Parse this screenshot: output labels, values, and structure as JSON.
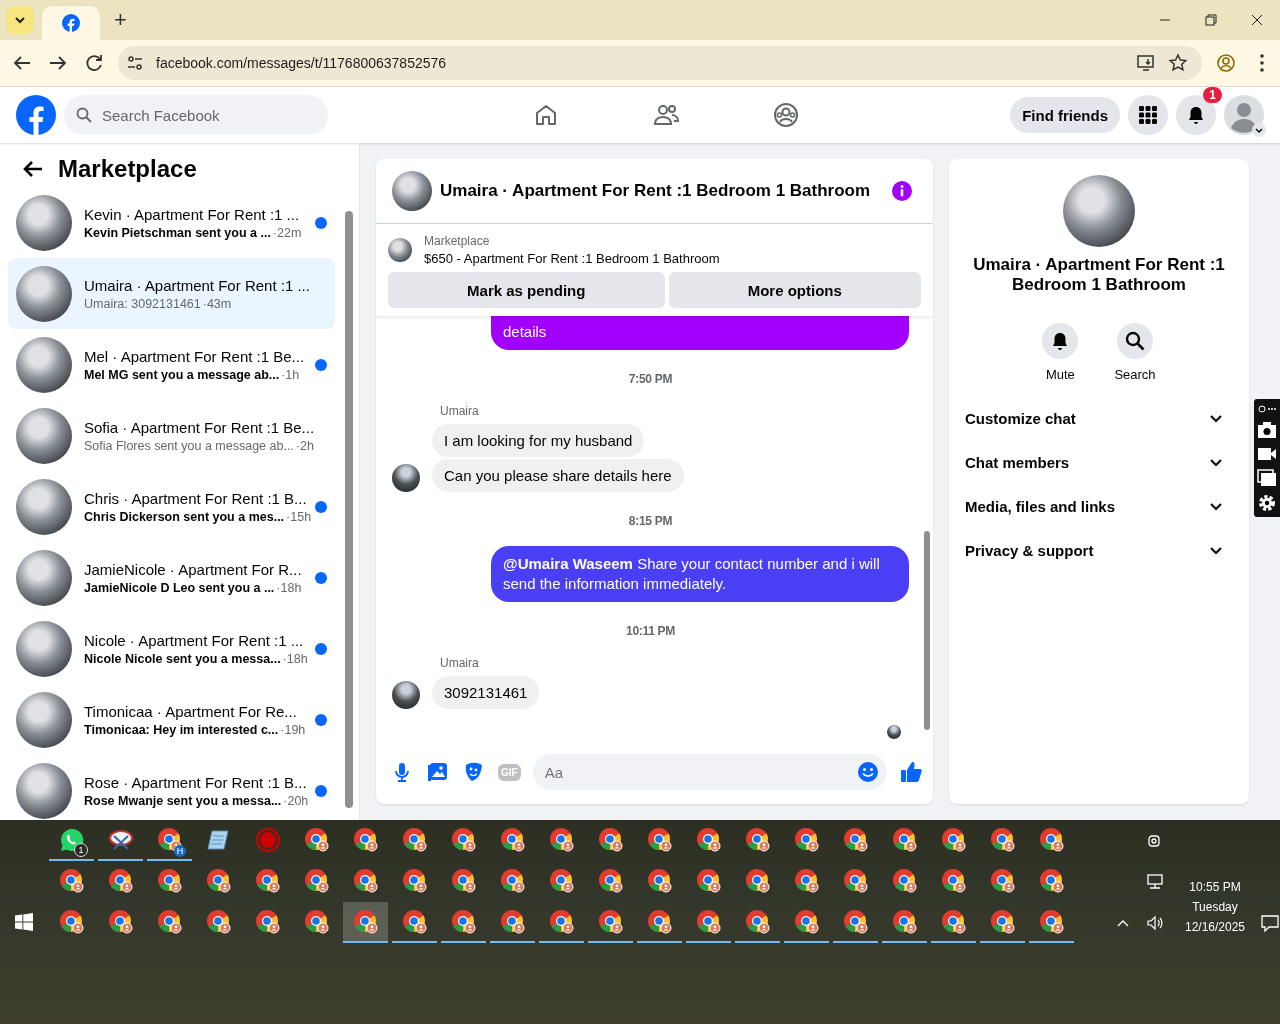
{
  "browser": {
    "url": "facebook.com/messages/t/1176800637852576",
    "new_tab": "+"
  },
  "header": {
    "search": {
      "placeholder": "Search Facebook"
    },
    "nav": [
      {
        "kind": "home",
        "selected": false
      },
      {
        "kind": "friends",
        "selected": false
      },
      {
        "kind": "groups",
        "selected": false
      }
    ],
    "find_friends": "Find friends",
    "notification_count": "1"
  },
  "conversations": {
    "title": "Marketplace",
    "items": [
      {
        "title": "Kevin · Apartment For Rent :1 ...",
        "preview": "Kevin Pietschman sent you a ...",
        "time": "·22m",
        "unread": true,
        "selected": false
      },
      {
        "title": "Umaira · Apartment For Rent :1 ...",
        "preview": "Umaira: 3092131461",
        "time": "·43m",
        "unread": false,
        "selected": true
      },
      {
        "title": "Mel · Apartment For Rent :1 Be...",
        "preview": "Mel MG sent you a message ab...",
        "time": "·1h",
        "unread": true,
        "selected": false
      },
      {
        "title": "Sofia · Apartment For Rent :1 Be...",
        "preview": "Sofia Flores sent you a message ab...",
        "time": "·2h",
        "unread": false,
        "selected": false
      },
      {
        "title": "Chris · Apartment For Rent :1 B...",
        "preview": "Chris Dickerson sent you a mes...",
        "time": "·15h",
        "unread": true,
        "selected": false
      },
      {
        "title": "JamieNicole · Apartment For R...",
        "preview": "JamieNicole D Leo sent you a ...",
        "time": "·18h",
        "unread": true,
        "selected": false
      },
      {
        "title": "Nicole · Apartment For Rent :1 ...",
        "preview": "Nicole Nicole sent you a messa...",
        "time": "·18h",
        "unread": true,
        "selected": false
      },
      {
        "title": "Timonicaa · Apartment For Re...",
        "preview": "Timonicaa: Hey im interested c...",
        "time": "·19h",
        "unread": true,
        "selected": false
      },
      {
        "title": "Rose · Apartment For Rent :1 B...",
        "preview": "Rose Mwanje sent you a messa...",
        "time": "·20h",
        "unread": true,
        "selected": false
      }
    ]
  },
  "chat": {
    "title": "Umaira · Apartment For Rent :1 Bedroom 1 Bathroom",
    "listing": {
      "label": "Marketplace",
      "title": "$650 - Apartment For Rent :1 Bedroom 1 Bathroom"
    },
    "buttons": [
      "Mark as pending",
      "More options"
    ],
    "messages": [
      {
        "kind": "sent",
        "text": "details",
        "color": "#a100ff"
      },
      {
        "kind": "time",
        "text": "7:50 PM"
      },
      {
        "kind": "received",
        "sender": "Umaira",
        "bubbles": [
          "I am looking for my husband",
          "Can you please share details here"
        ]
      },
      {
        "kind": "time",
        "text": "8:15 PM"
      },
      {
        "kind": "sent",
        "text": "**@Umaira Waseem** Share your contact number and i will send the information immediately.",
        "color": "#4b3ff5"
      },
      {
        "kind": "time",
        "text": "10:11 PM"
      },
      {
        "kind": "received",
        "sender": "Umaira",
        "bubbles": [
          "3092131461"
        ]
      },
      {
        "kind": "seen"
      }
    ],
    "composer": {
      "gif": "GIF",
      "placeholder": "Aa"
    }
  },
  "details": {
    "title": "Umaira · Apartment For Rent :1 Bedroom 1 Bathroom",
    "actions": [
      {
        "kind": "mute",
        "label": "Mute"
      },
      {
        "kind": "search",
        "label": "Search"
      }
    ],
    "sections": [
      {
        "label": "Customize chat",
        "expanded": false
      },
      {
        "label": "Chat members",
        "expanded": false
      },
      {
        "label": "Media, files and links",
        "expanded": false
      },
      {
        "label": "Privacy & support",
        "expanded": false
      }
    ]
  },
  "taskbar": {
    "rows": [
      [
        {
          "kind": "chat",
          "badge": "1",
          "running": true,
          "selected": false
        },
        {
          "kind": "snip",
          "running": true,
          "selected": false
        },
        {
          "kind": "browser",
          "badge": "H",
          "running": true,
          "selected": false
        },
        {
          "kind": "notes",
          "running": false,
          "selected": false
        },
        {
          "kind": "record",
          "running": false,
          "selected": false
        },
        {
          "kind": "browser",
          "running": false,
          "selected": false
        },
        {
          "kind": "browser",
          "running": false,
          "selected": false
        },
        {
          "kind": "browser",
          "running": false,
          "selected": false
        },
        {
          "kind": "browser",
          "running": false,
          "selected": false
        },
        {
          "kind": "browser",
          "running": false,
          "selected": false
        },
        {
          "kind": "browser",
          "running": false,
          "selected": false
        },
        {
          "kind": "browser",
          "running": false,
          "selected": false
        },
        {
          "kind": "browser",
          "running": false,
          "selected": false
        },
        {
          "kind": "browser",
          "running": false,
          "selected": false
        },
        {
          "kind": "browser",
          "running": false,
          "selected": false
        },
        {
          "kind": "browser",
          "running": false,
          "selected": false
        },
        {
          "kind": "browser",
          "running": false,
          "selected": false
        },
        {
          "kind": "browser",
          "running": false,
          "selected": false
        },
        {
          "kind": "browser",
          "running": false,
          "selected": false
        },
        {
          "kind": "browser",
          "running": false,
          "selected": false
        },
        {
          "kind": "browser",
          "running": false,
          "selected": false
        }
      ],
      [
        {
          "kind": "browser",
          "running": false,
          "selected": false
        },
        {
          "kind": "browser",
          "running": false,
          "selected": false
        },
        {
          "kind": "browser",
          "running": false,
          "selected": false
        },
        {
          "kind": "browser",
          "running": false,
          "selected": false
        },
        {
          "kind": "browser",
          "running": false,
          "selected": false
        },
        {
          "kind": "browser",
          "running": false,
          "selected": false
        },
        {
          "kind": "browser",
          "running": false,
          "selected": false
        },
        {
          "kind": "browser",
          "running": false,
          "selected": false
        },
        {
          "kind": "browser",
          "running": false,
          "selected": false
        },
        {
          "kind": "browser",
          "running": false,
          "selected": false
        },
        {
          "kind": "browser",
          "running": false,
          "selected": false
        },
        {
          "kind": "browser",
          "running": false,
          "selected": false
        },
        {
          "kind": "browser",
          "running": false,
          "selected": false
        },
        {
          "kind": "browser",
          "running": false,
          "selected": false
        },
        {
          "kind": "browser",
          "running": false,
          "selected": false
        },
        {
          "kind": "browser",
          "running": false,
          "selected": false
        },
        {
          "kind": "browser",
          "running": false,
          "selected": false
        },
        {
          "kind": "browser",
          "running": false,
          "selected": false
        },
        {
          "kind": "browser",
          "running": false,
          "selected": false
        },
        {
          "kind": "browser",
          "running": false,
          "selected": false
        },
        {
          "kind": "browser",
          "running": false,
          "selected": false
        }
      ],
      [
        {
          "kind": "browser",
          "running": false,
          "selected": false
        },
        {
          "kind": "browser",
          "running": false,
          "selected": false
        },
        {
          "kind": "browser",
          "running": false,
          "selected": false
        },
        {
          "kind": "browser",
          "running": false,
          "selected": false
        },
        {
          "kind": "browser",
          "running": false,
          "selected": false
        },
        {
          "kind": "browser",
          "running": false,
          "selected": false
        },
        {
          "kind": "browser",
          "running": true,
          "selected": true
        },
        {
          "kind": "browser",
          "running": true,
          "selected": false
        },
        {
          "kind": "browser",
          "running": true,
          "selected": false
        },
        {
          "kind": "browser",
          "running": true,
          "selected": false
        },
        {
          "kind": "browser",
          "running": true,
          "selected": false
        },
        {
          "kind": "browser",
          "running": true,
          "selected": false
        },
        {
          "kind": "browser",
          "running": true,
          "selected": false
        },
        {
          "kind": "browser",
          "running": true,
          "selected": false
        },
        {
          "kind": "browser",
          "running": true,
          "selected": false
        },
        {
          "kind": "browser",
          "running": true,
          "selected": false
        },
        {
          "kind": "browser",
          "running": true,
          "selected": false
        },
        {
          "kind": "browser",
          "running": true,
          "selected": false
        },
        {
          "kind": "browser",
          "running": true,
          "selected": false
        },
        {
          "kind": "browser",
          "running": true,
          "selected": false
        },
        {
          "kind": "browser",
          "running": true,
          "selected": false
        }
      ]
    ],
    "time": "10:55 PM",
    "day": "Tuesday",
    "date": "12/16/2025"
  }
}
